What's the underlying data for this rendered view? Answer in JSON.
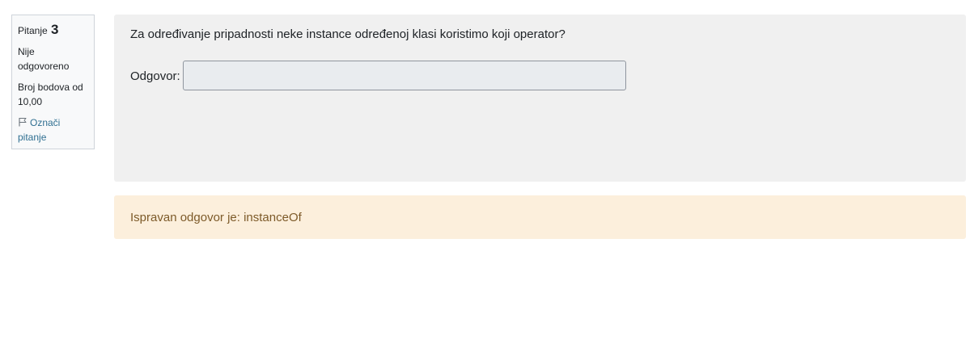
{
  "question_info": {
    "label": "Pitanje",
    "number": "3",
    "state": "Nije odgovoreno",
    "grade": "Broj bodova od 10,00",
    "flag_label": "Označi pitanje"
  },
  "question": {
    "text": "Za određivanje pripadnosti neke instance određenoj klasi koristimo koji operator?",
    "answer_label": "Odgovor:",
    "answer_value": ""
  },
  "feedback": {
    "right_answer": "Ispravan odgovor je: instanceOf"
  },
  "colors": {
    "info_background": "#f8f9fa",
    "content_background": "#f0f0f0",
    "feedback_background": "#fcefdc",
    "feedback_text": "#7d5a29",
    "link": "#2f6f91"
  },
  "icons": {
    "flag": "flag-icon"
  }
}
